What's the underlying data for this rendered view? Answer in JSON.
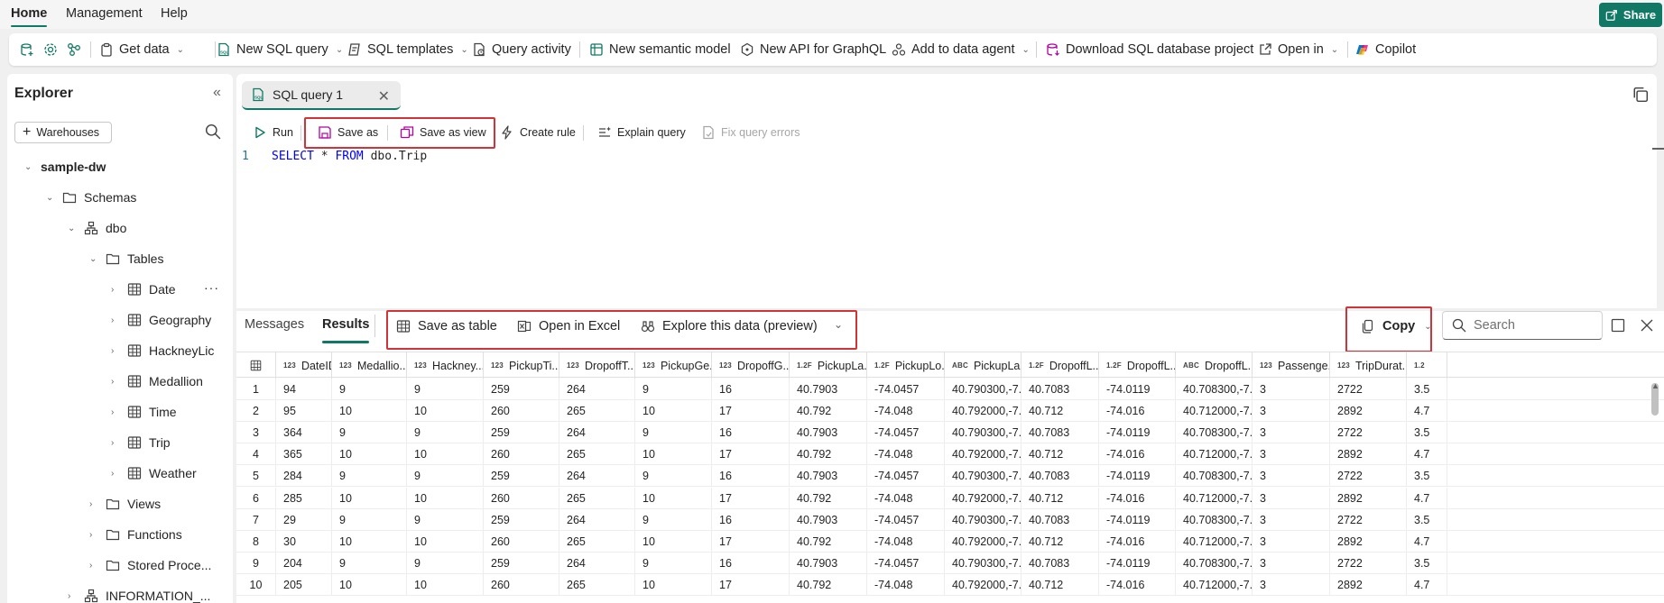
{
  "topnav": {
    "tabs": [
      "Home",
      "Management",
      "Help"
    ],
    "share_label": "Share"
  },
  "toolbar": {
    "get_data": "Get data",
    "new_sql_query": "New SQL query",
    "sql_templates": "SQL templates",
    "query_activity": "Query activity",
    "new_semantic_model": "New semantic model",
    "new_api_graphql": "New API for GraphQL",
    "add_to_data_agent": "Add to data agent",
    "download_project": "Download SQL database project",
    "open_in": "Open in",
    "copilot": "Copilot"
  },
  "explorer": {
    "title": "Explorer",
    "warehouses_button": "Warehouses",
    "tree": {
      "warehouse": "sample-dw",
      "schemas": "Schemas",
      "dbo": "dbo",
      "tables": "Tables",
      "table_items": [
        "Date",
        "Geography",
        "HackneyLic",
        "Medallion",
        "Time",
        "Trip",
        "Weather"
      ],
      "views": "Views",
      "functions": "Functions",
      "stored_procedures": "Stored Proce...",
      "information_schema": "INFORMATION_..."
    }
  },
  "editor": {
    "tab_title": "SQL query 1",
    "run": "Run",
    "save_as": "Save as",
    "save_as_view": "Save as view",
    "create_rule": "Create rule",
    "explain_query": "Explain query",
    "fix_query_errors": "Fix query errors",
    "line_number": "1",
    "code": {
      "kw1": "SELECT",
      "star": " * ",
      "kw2": "FROM",
      "rest": " dbo.Trip"
    }
  },
  "results": {
    "tabs": [
      "Messages",
      "Results"
    ],
    "save_as_table": "Save as table",
    "open_in_excel": "Open in Excel",
    "explore_data": "Explore this data (preview)",
    "copy": "Copy",
    "search_placeholder": "Search",
    "columns": [
      {
        "type": "123",
        "name": "DateID"
      },
      {
        "type": "123",
        "name": "Medallio..."
      },
      {
        "type": "123",
        "name": "Hackney..."
      },
      {
        "type": "123",
        "name": "PickupTi..."
      },
      {
        "type": "123",
        "name": "DropoffT..."
      },
      {
        "type": "123",
        "name": "PickupGe..."
      },
      {
        "type": "123",
        "name": "DropoffG..."
      },
      {
        "type": "1.2F",
        "name": "PickupLa..."
      },
      {
        "type": "1.2F",
        "name": "PickupLo..."
      },
      {
        "type": "ABC",
        "name": "PickupLa..."
      },
      {
        "type": "1.2F",
        "name": "DropoffL..."
      },
      {
        "type": "1.2F",
        "name": "DropoffL..."
      },
      {
        "type": "ABC",
        "name": "DropoffL..."
      },
      {
        "type": "123",
        "name": "Passenge..."
      },
      {
        "type": "123",
        "name": "TripDurat..."
      },
      {
        "type": "1.2",
        "name": ""
      }
    ],
    "rows": [
      [
        "1",
        "94",
        "9",
        "9",
        "259",
        "264",
        "9",
        "16",
        "40.7903",
        "-74.0457",
        "40.790300,-7...",
        "40.7083",
        "-74.0119",
        "40.708300,-7...",
        "3",
        "2722",
        "3.5"
      ],
      [
        "2",
        "95",
        "10",
        "10",
        "260",
        "265",
        "10",
        "17",
        "40.792",
        "-74.048",
        "40.792000,-7...",
        "40.712",
        "-74.016",
        "40.712000,-7...",
        "3",
        "2892",
        "4.7"
      ],
      [
        "3",
        "364",
        "9",
        "9",
        "259",
        "264",
        "9",
        "16",
        "40.7903",
        "-74.0457",
        "40.790300,-7...",
        "40.7083",
        "-74.0119",
        "40.708300,-7...",
        "3",
        "2722",
        "3.5"
      ],
      [
        "4",
        "365",
        "10",
        "10",
        "260",
        "265",
        "10",
        "17",
        "40.792",
        "-74.048",
        "40.792000,-7...",
        "40.712",
        "-74.016",
        "40.712000,-7...",
        "3",
        "2892",
        "4.7"
      ],
      [
        "5",
        "284",
        "9",
        "9",
        "259",
        "264",
        "9",
        "16",
        "40.7903",
        "-74.0457",
        "40.790300,-7...",
        "40.7083",
        "-74.0119",
        "40.708300,-7...",
        "3",
        "2722",
        "3.5"
      ],
      [
        "6",
        "285",
        "10",
        "10",
        "260",
        "265",
        "10",
        "17",
        "40.792",
        "-74.048",
        "40.792000,-7...",
        "40.712",
        "-74.016",
        "40.712000,-7...",
        "3",
        "2892",
        "4.7"
      ],
      [
        "7",
        "29",
        "9",
        "9",
        "259",
        "264",
        "9",
        "16",
        "40.7903",
        "-74.0457",
        "40.790300,-7...",
        "40.7083",
        "-74.0119",
        "40.708300,-7...",
        "3",
        "2722",
        "3.5"
      ],
      [
        "8",
        "30",
        "10",
        "10",
        "260",
        "265",
        "10",
        "17",
        "40.792",
        "-74.048",
        "40.792000,-7...",
        "40.712",
        "-74.016",
        "40.712000,-7...",
        "3",
        "2892",
        "4.7"
      ],
      [
        "9",
        "204",
        "9",
        "9",
        "259",
        "264",
        "9",
        "16",
        "40.7903",
        "-74.0457",
        "40.790300,-7...",
        "40.7083",
        "-74.0119",
        "40.708300,-7...",
        "3",
        "2722",
        "3.5"
      ],
      [
        "10",
        "205",
        "10",
        "10",
        "260",
        "265",
        "10",
        "17",
        "40.792",
        "-74.048",
        "40.792000,-7...",
        "40.712",
        "-74.016",
        "40.712000,-7...",
        "3",
        "2892",
        "4.7"
      ]
    ]
  },
  "colors": {
    "accent": "#117865",
    "highlight_box": "#d13438",
    "sql_keyword": "#0000ff"
  }
}
